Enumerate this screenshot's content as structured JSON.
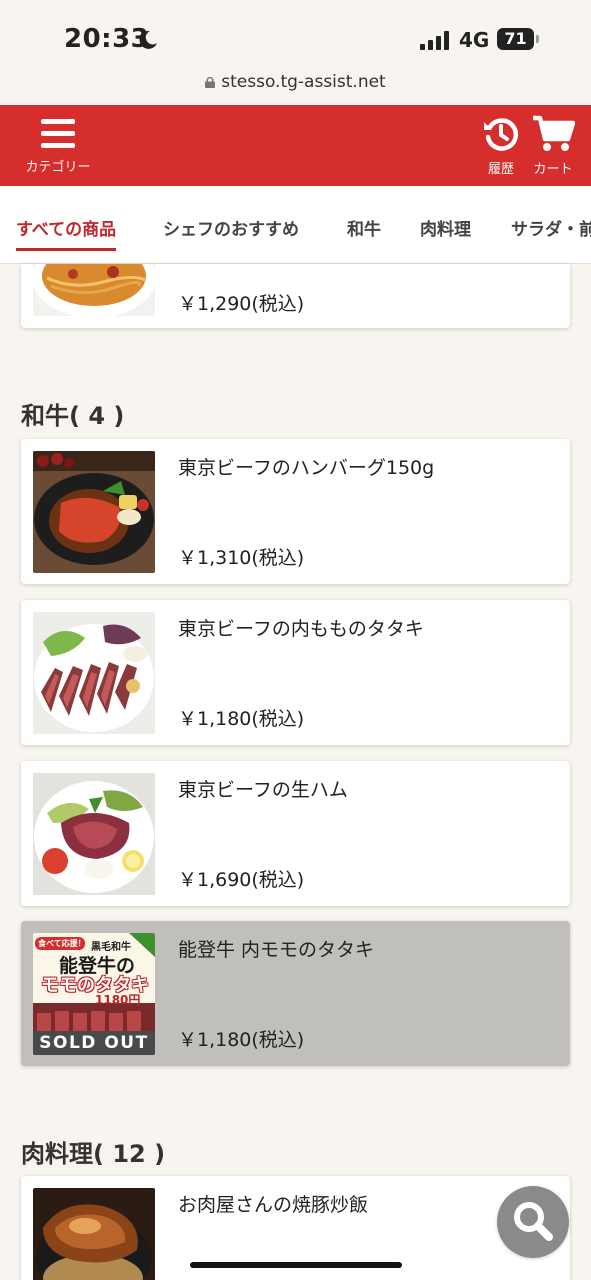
{
  "status_bar": {
    "time": "20:33",
    "network": "4G",
    "battery": "71"
  },
  "browser": {
    "url": "stesso.tg-assist.net"
  },
  "header": {
    "menu_label": "カテゴリー",
    "history_label": "履歴",
    "cart_label": "カート"
  },
  "tabs": [
    {
      "label": "すべての商品",
      "active": true
    },
    {
      "label": "シェフのおすすめ"
    },
    {
      "label": "和牛"
    },
    {
      "label": "肉料理"
    },
    {
      "label": "サラダ・前"
    }
  ],
  "prev_item": {
    "price": "￥1,290(税込)"
  },
  "sections": [
    {
      "title": "和牛( 4 )",
      "items": [
        {
          "name": "東京ビーフのハンバーグ150g",
          "price": "￥1,310(税込)"
        },
        {
          "name": "東京ビーフの内もものタタキ",
          "price": "￥1,180(税込)"
        },
        {
          "name": "東京ビーフの生ハム",
          "price": "￥1,690(税込)"
        },
        {
          "name": "能登牛 内モモのタタキ",
          "price": "￥1,180(税込)",
          "sold_out": true,
          "badge": "SOLD OUT",
          "poster": {
            "tag": "食べて応援！",
            "kuroge": "黒毛和牛",
            "line1": "能登牛の",
            "line2": "モモのタタキ",
            "price": "1180円"
          }
        }
      ]
    },
    {
      "title": "肉料理( 12 )",
      "items": [
        {
          "name": "お肉屋さんの焼豚炒飯"
        }
      ]
    }
  ],
  "colors": {
    "header": "#d62d2d",
    "accent": "#c0262a",
    "background": "#f8f5f0",
    "sold_out_card": "#c0bfbc"
  },
  "icons": [
    "hamburger-menu-icon",
    "history-icon",
    "cart-icon",
    "search-icon",
    "lock-icon",
    "moon-icon"
  ]
}
